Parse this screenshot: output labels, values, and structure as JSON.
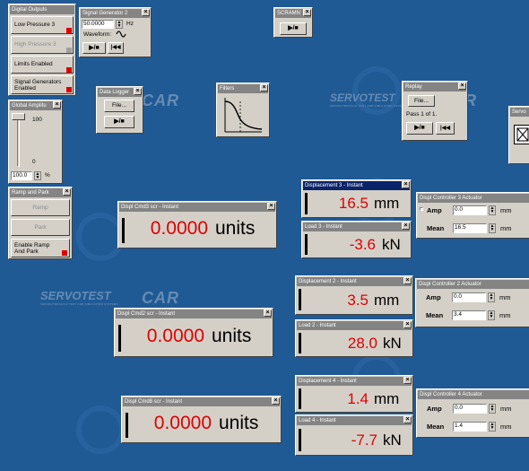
{
  "watermark": {
    "brand": "SERVOTEST",
    "sub": "SERVOHYDRAULIC TEST AND SIMULATION SYSTEMS"
  },
  "digital_outputs": {
    "title": "Digital Outputs",
    "buttons": [
      "Low Pressure 3",
      "High Pressure 3",
      "Limits Enabled",
      "Signal Generators Enabled"
    ]
  },
  "signal_generator": {
    "title": "Signal Generator 2",
    "freq": "50.0000",
    "freq_unit": "Hz",
    "waveform_label": "Waveform:",
    "play_stop": "▶/■",
    "rewind": "|◀◀"
  },
  "scramnet": {
    "title": "SCRAMN",
    "play_stop": "▶/■"
  },
  "data_logger": {
    "title": "Data Logger",
    "file_btn": "File...",
    "play_stop": "▶/■"
  },
  "filters": {
    "title": "Filters"
  },
  "replay": {
    "title": "Replay",
    "file_btn": "File...",
    "pass_text": "Pass 1 of 1.",
    "play_stop": "▶/■",
    "rewind": "|◀◀"
  },
  "servo": {
    "title": "Servo"
  },
  "global_amplitude": {
    "title": "Global Amplitu",
    "top": "100",
    "bottom": "0",
    "value": "100.0",
    "unit": "%",
    "level": 1.0
  },
  "ramp_and_park": {
    "title": "Ramp and Park",
    "ramp": "Ramp",
    "park": "Park",
    "enable": "Enable Ramp And Park"
  },
  "displays": {
    "cmd3": {
      "title": "Displ Cmd3 scr - Instant",
      "value": "0.0000",
      "unit": "units"
    },
    "cmd2": {
      "title": "Displ Cmd2 scr - Instant",
      "value": "0.0000",
      "unit": "units"
    },
    "cmd8": {
      "title": "Displ Cmd8 scr - Instant",
      "value": "0.0000",
      "unit": "units"
    },
    "disp3": {
      "title": "Displacement 3 - Instant",
      "value": "16.5",
      "unit": "mm"
    },
    "load3": {
      "title": "Load 3 - Instant",
      "value": "-3.6",
      "unit": "kN"
    },
    "disp2": {
      "title": "Displacement 2 - Instant",
      "value": "3.5",
      "unit": "mm"
    },
    "load2": {
      "title": "Load 2 - Instant",
      "value": "28.0",
      "unit": "kN"
    },
    "disp4": {
      "title": "Displacement 4 - Instant",
      "value": "1.4",
      "unit": "mm"
    },
    "load4": {
      "title": "Load 4 - Instant",
      "value": "-7.7",
      "unit": "kN"
    }
  },
  "controllers": {
    "c3": {
      "title": "Displ Controller 3 Actuator",
      "amp_label": "Amp",
      "amp": "0.0",
      "mean_label": "Mean",
      "mean": "16.5",
      "unit": "mm"
    },
    "c2": {
      "title": "Displ Controller 2 Actuator",
      "amp_label": "Amp",
      "amp": "0.0",
      "mean_label": "Mean",
      "mean": "3.4",
      "unit": "mm"
    },
    "c4": {
      "title": "Displ Controller 4 Actuator",
      "amp_label": "Amp",
      "amp": "0.0",
      "mean_label": "Mean",
      "mean": "1.4",
      "unit": "mm"
    }
  },
  "colors": {
    "desktop": "#1f5a94",
    "value_red": "#e00000",
    "titlebar_inactive": "#848484",
    "titlebar_active": "#0a246a"
  }
}
